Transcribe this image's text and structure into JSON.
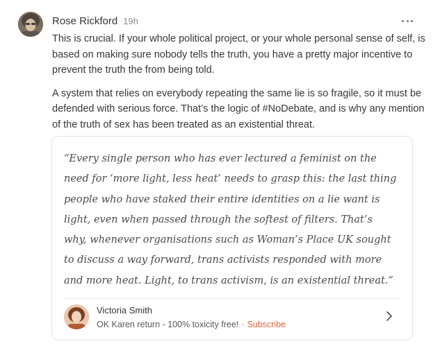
{
  "post": {
    "author": "Rose Rickford",
    "time": "19h",
    "paragraphs": [
      "This is crucial. If your whole political project, or your whole personal sense of self, is based on making sure nobody tells the truth, you have a pretty major incentive to prevent the truth the from being told.",
      "A system that relies on everybody repeating the same lie is so fragile, so it must be defended with serious force. That’s the logic of #NoDebate, and is why any mention of the truth of sex has been treated as an existential threat."
    ]
  },
  "quote": {
    "text": "“Every single person who has ever lectured a feminist on the need for ‘more light, less heat’ needs to grasp this: the last thing people who have staked their entire identities on a lie want is light, even when passed through the softest of filters. That’s why, whenever organisations such as Woman’s Place UK sought to discuss a way forward, trans activists responded with more and more heat. Light, to trans activism, is an existential threat.”"
  },
  "source": {
    "name": "Victoria Smith",
    "publication": "OK Karen return - 100% toxicity free!",
    "separator": "·",
    "subscribe_label": "Subscribe"
  },
  "icons": {
    "more": "more-horizontal-icon",
    "chevron": "chevron-right-icon"
  },
  "colors": {
    "accent": "#e8663a",
    "text": "#363737",
    "muted": "#8a8a8a",
    "border": "#e3e3e3"
  }
}
